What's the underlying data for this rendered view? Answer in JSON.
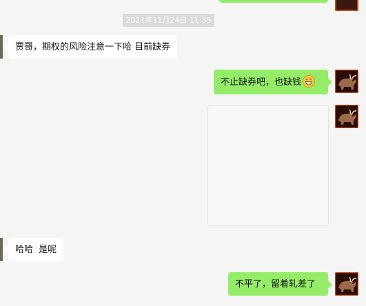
{
  "chat": {
    "timestamp": "2021年11月24日 11:35",
    "messages": [
      {
        "side": "left",
        "text": "贾哥，期权的风险注意一下哈 目前缺券"
      },
      {
        "side": "right",
        "text": "不止缺券吧，也缺钱",
        "emoji": "grinning-face-emoji"
      },
      {
        "side": "right",
        "type": "image"
      },
      {
        "side": "left",
        "text": "哈哈  是呢"
      },
      {
        "side": "right",
        "text": "不平了，留着轧差了"
      }
    ]
  },
  "colors": {
    "background": "#f5f5f5",
    "bubble_self": "#95ec69",
    "bubble_other": "#ffffff",
    "timestamp_bg": "#dadada"
  },
  "icons": [
    "bull-avatar-icon",
    "grinning-face-emoji"
  ]
}
